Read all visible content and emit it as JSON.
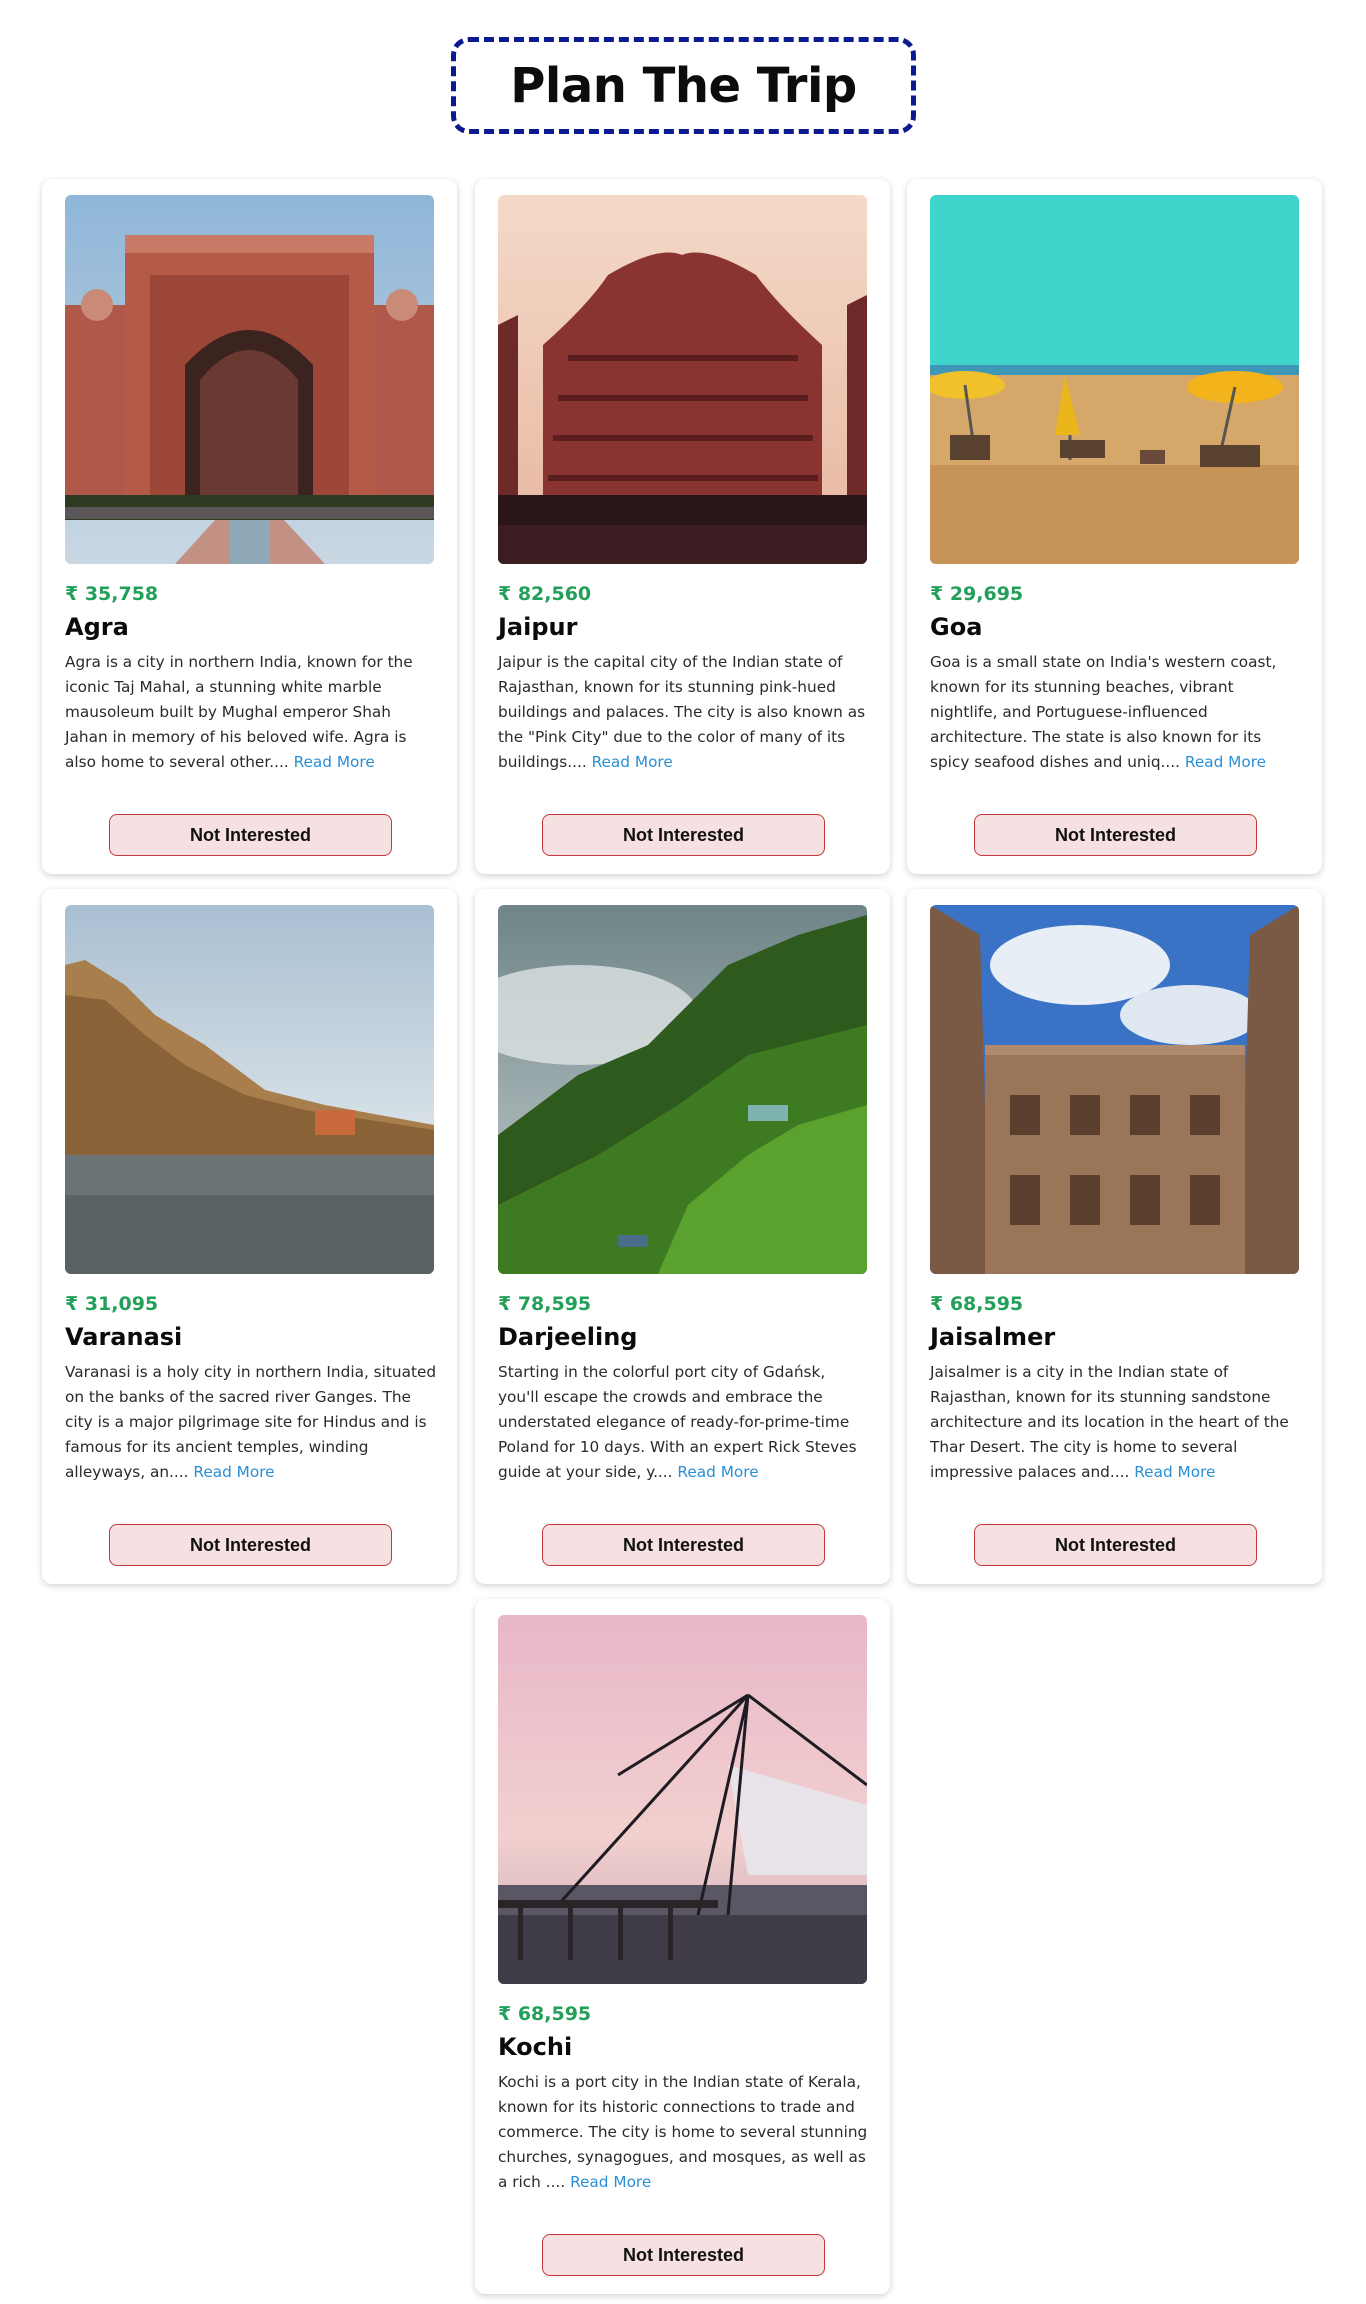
{
  "page": {
    "title": "Plan The Trip"
  },
  "tours": [
    {
      "price": "₹ 35,758",
      "name": "Agra",
      "info": "Agra is a city in northern India, known for the iconic Taj Mahal, a stunning white marble mausoleum built by Mughal emperor Shah Jahan in memory of his beloved wife. Agra is also home to several other....",
      "read_more": "Read More",
      "button": "Not Interested"
    },
    {
      "price": "₹ 82,560",
      "name": "Jaipur",
      "info": "Jaipur is the capital city of the Indian state of Rajasthan, known for its stunning pink-hued buildings and palaces. The city is also known as the \"Pink City\" due to the color of many of its buildings....",
      "read_more": "Read More",
      "button": "Not Interested"
    },
    {
      "price": "₹ 29,695",
      "name": "Goa",
      "info": "Goa is a small state on India's western coast, known for its stunning beaches, vibrant nightlife, and Portuguese-influenced architecture. The state is also known for its spicy seafood dishes and uniq....",
      "read_more": "Read More",
      "button": "Not Interested"
    },
    {
      "price": "₹ 31,095",
      "name": "Varanasi",
      "info": "Varanasi is a holy city in northern India, situated on the banks of the sacred river Ganges. The city is a major pilgrimage site for Hindus and is famous for its ancient temples, winding alleyways, an....",
      "read_more": "Read More",
      "button": "Not Interested"
    },
    {
      "price": "₹ 78,595",
      "name": "Darjeeling",
      "info": "Starting in the colorful port city of Gdańsk, you'll escape the crowds and embrace the understated elegance of ready-for-prime-time Poland for 10 days. With an expert Rick Steves guide at your side, y....",
      "read_more": "Read More",
      "button": "Not Interested"
    },
    {
      "price": "₹ 68,595",
      "name": "Jaisalmer",
      "info": "Jaisalmer is a city in the Indian state of Rajasthan, known for its stunning sandstone architecture and its location in the heart of the Thar Desert. The city is home to several impressive palaces and....",
      "read_more": "Read More",
      "button": "Not Interested"
    },
    {
      "price": "₹ 68,595",
      "name": "Kochi",
      "info": "Kochi is a port city in the Indian state of Kerala, known for its historic connections to trade and commerce. The city is home to several stunning churches, synagogues, and mosques, as well as a rich ....",
      "read_more": "Read More",
      "button": "Not Interested"
    }
  ],
  "colors": {
    "price": "#22a05a",
    "link": "#2a8fd6",
    "title_border": "#0b1b8f",
    "button_bg": "#f6e0e2",
    "button_border": "#c0393b"
  }
}
